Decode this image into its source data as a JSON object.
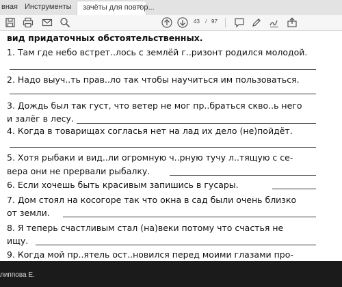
{
  "tabs": {
    "left_partial": "вная",
    "tools": "Инструменты",
    "active": "зачёты для повтор...",
    "close": "×"
  },
  "toolbar": {
    "icons": [
      "save-icon",
      "print-icon",
      "mail-icon",
      "zoom-icon",
      "page-up-icon",
      "page-down-icon",
      "comment-icon",
      "pen-icon",
      "sign-icon",
      "share-icon"
    ],
    "page_current": "43",
    "page_separator": "/",
    "page_total": "97"
  },
  "document": {
    "heading": "вид придаточных обстоятельственных.",
    "lines": [
      "1. Там где небо встрет..лось с землёй г..ризонт родился молодой.",
      "2. Надо выуч..ть прав..ло так чтобы научиться им пользоваться.",
      "3. Дождь был так густ, что ветер не мог пр..браться скво..ь него",
      "и залёг в лесу.",
      "4. Когда в товарищах согласья нет на лад их дело (не)пойдёт.",
      "5. Хотя рыбаки и вид..ли огромную ч..рную тучу л..тящую с се-",
      "вера они не прервали рыбалку.",
      "6. Если хочешь быть красивым запишись в гусары.",
      "7. Дом стоял на косогоре так что окна в сад были очень близко",
      "от земли.",
      "8. Я теперь счастливым стал (на)веки потому что счастья не",
      "ищу.",
      "9. Когда мой пр..ятель ост..новился перед моими глазами про-"
    ]
  },
  "bottom": {
    "user_partial": "липпова Е."
  }
}
